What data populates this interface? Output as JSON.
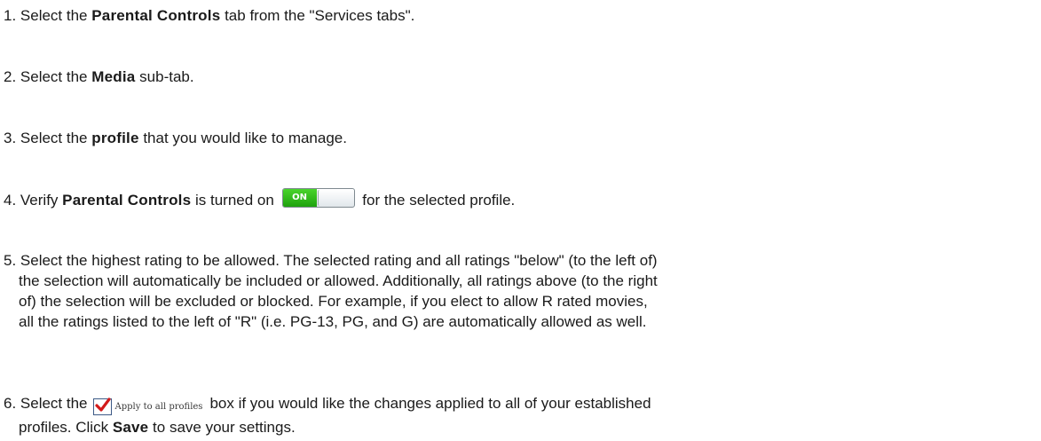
{
  "steps": [
    {
      "num": "1.",
      "pre": " Select the ",
      "bold": "Parental Controls",
      "post": " tab from the \"Services tabs\"."
    },
    {
      "num": "2.",
      "pre": " Select the ",
      "bold": "Media",
      "post": " sub-tab."
    },
    {
      "num": "3.",
      "pre": " Select the ",
      "bold": "profile",
      "post": " that you would like to manage."
    },
    {
      "num": "4.",
      "pre": " Verify ",
      "bold": "Parental Controls",
      "mid": " is turned on",
      "toggle_label": "ON",
      "post": "for the selected profile."
    },
    {
      "num": "5.",
      "lines": [
        " Select the highest rating to be allowed. The selected rating and all ratings \"below\" (to the left of)",
        "the selection will automatically be included or allowed. Additionally, all ratings above (to the right",
        "of) the selection will be excluded or blocked.  For example, if you elect to allow R rated movies,",
        "all the ratings listed to the left of \"R\" (i.e. PG-13, PG, and G) are automatically allowed as well."
      ]
    },
    {
      "num": "6.",
      "pre": " Select the",
      "checkbox_label": "Apply to all profiles",
      "mid": "box if you would like the changes applied to all of your established",
      "line2_pre": "profiles. Click ",
      "line2_bold": "Save",
      "line2_post": " to save your settings."
    }
  ],
  "colors": {
    "text": "#1a1a1a",
    "toggle_on": "#2cb81a",
    "checkmark": "#d21a1a",
    "checkbox_border": "#3d5a86"
  }
}
